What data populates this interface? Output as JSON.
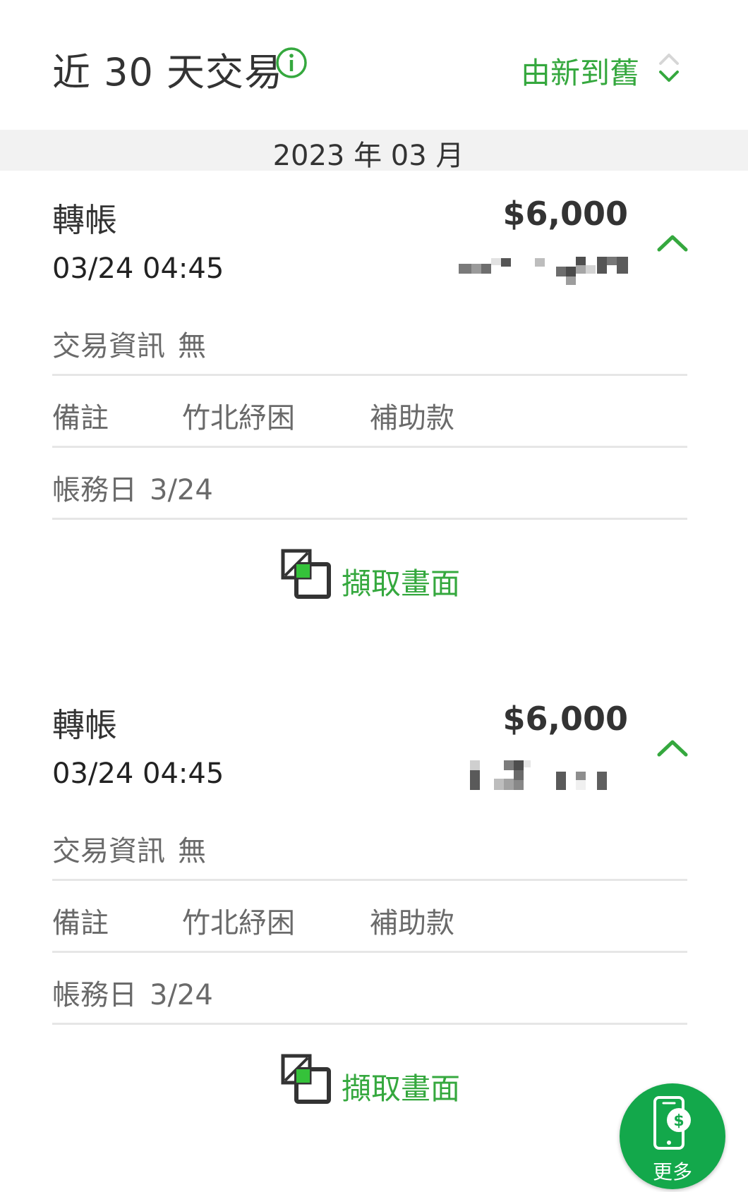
{
  "header": {
    "title": "近 30 天交易",
    "sort_label": "由新到舊"
  },
  "month_label": "2023 年 03 月",
  "transactions": [
    {
      "type": "轉帳",
      "amount": "$6,000",
      "time": "03/24 04:45",
      "info_label": "交易資訊",
      "info_value": "無",
      "note_label": "備註",
      "note_part1": "竹北紓困",
      "note_part2": "補助款",
      "date_label": "帳務日",
      "date_value": "3/24",
      "capture_label": "擷取畫面"
    },
    {
      "type": "轉帳",
      "amount": "$6,000",
      "time": "03/24 04:45",
      "info_label": "交易資訊",
      "info_value": "無",
      "note_label": "備註",
      "note_part1": "竹北紓困",
      "note_part2": "補助款",
      "date_label": "帳務日",
      "date_value": "3/24",
      "capture_label": "擷取畫面"
    }
  ],
  "more_button": {
    "label": "更多"
  },
  "colors": {
    "accent": "#35a83e",
    "fab": "#13a84b",
    "band": "#f2f2f2"
  }
}
